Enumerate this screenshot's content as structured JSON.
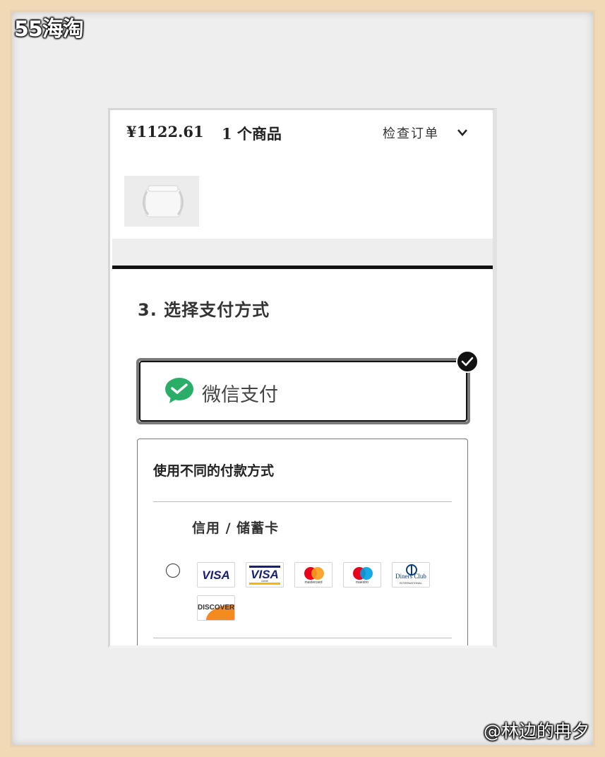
{
  "watermarks": {
    "top_left": "55海淘",
    "bottom_right": "@林边的冉夕"
  },
  "order": {
    "price": "¥1122.61",
    "item_count": "1 个商品",
    "review_label": "检查订单"
  },
  "payment": {
    "section_title": "3. 选择支付方式",
    "wechat": {
      "label": "微信支付",
      "selected": true
    },
    "other_methods": {
      "title": "使用不同的付款方式",
      "card_label": "信用 / 储蓄卡",
      "cards": [
        {
          "name": "VISA",
          "icon": "visa-logo"
        },
        {
          "name": "VISA",
          "sub": "Debit",
          "icon": "visa-debit-logo"
        },
        {
          "name": "mastercard",
          "icon": "mastercard-logo"
        },
        {
          "name": "maestro",
          "icon": "maestro-logo"
        },
        {
          "name": "Diners Club",
          "sub": "INTERNATIONAL",
          "icon": "diners-club-logo"
        },
        {
          "name": "DISCOVER",
          "icon": "discover-logo"
        }
      ]
    }
  },
  "colors": {
    "wechat_green": "#2aae67",
    "mastercard_red": "#eb001b",
    "mastercard_orange": "#f79e1b",
    "maestro_blue": "#009ee3",
    "visa_blue": "#1a1f71"
  }
}
